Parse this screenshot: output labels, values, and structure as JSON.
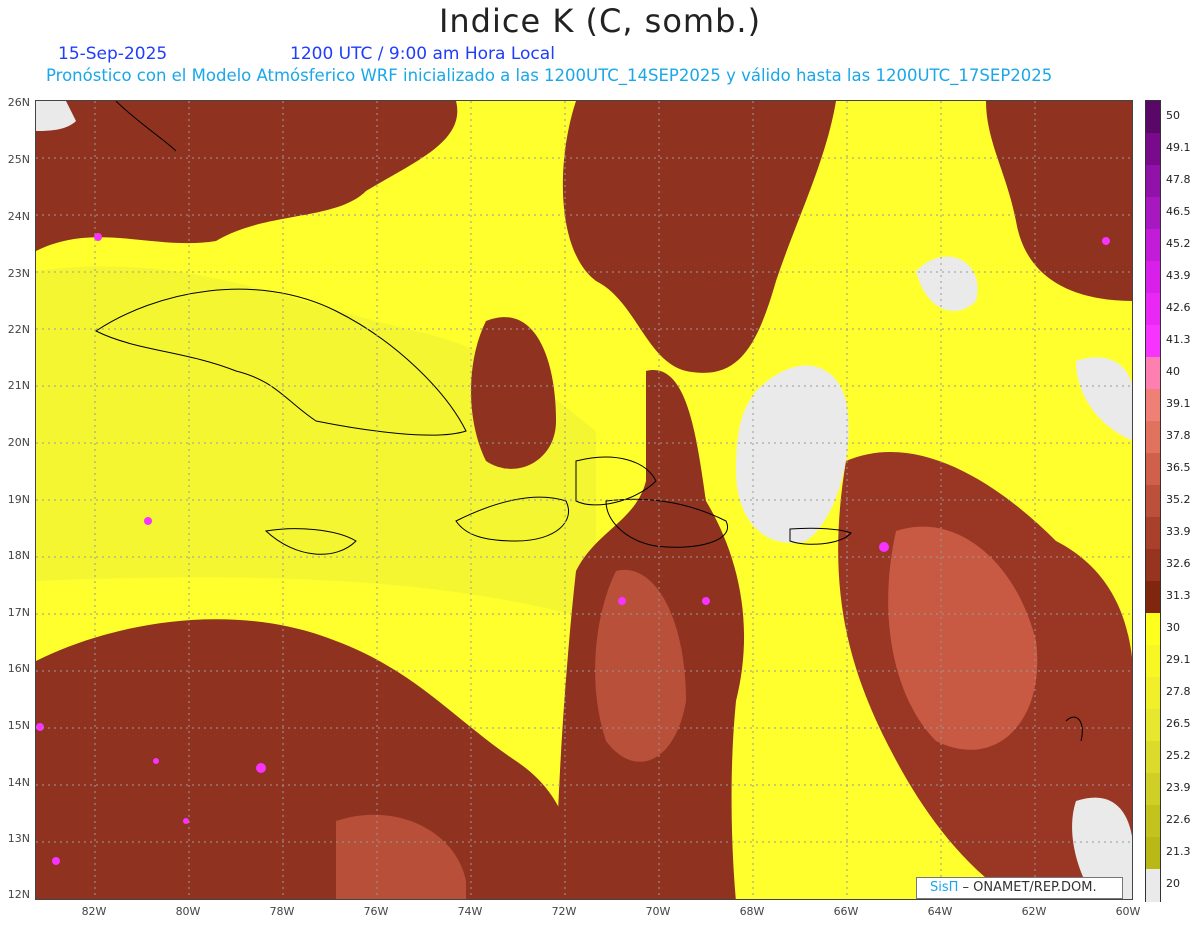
{
  "header": {
    "title": "Indice K (C, somb.)",
    "date": "15-Sep-2025",
    "time": "1200 UTC / 9:00 am Hora Local",
    "model_line": "Pronóstico con el Modelo Atmósferico WRF inicializado a las 1200UTC_14SEP2025 y válido hasta las  1200UTC_17SEP2025"
  },
  "axes": {
    "y_labels": [
      "26N",
      "25N",
      "24N",
      "23N",
      "22N",
      "21N",
      "20N",
      "19N",
      "18N",
      "17N",
      "16N",
      "15N",
      "14N",
      "13N",
      "12N"
    ],
    "x_labels": [
      "82W",
      "80W",
      "78W",
      "76W",
      "74W",
      "72W",
      "70W",
      "68W",
      "66W",
      "64W",
      "62W",
      "60W"
    ]
  },
  "colorbar": {
    "labels": [
      "50",
      "49.1",
      "47.8",
      "46.5",
      "45.2",
      "43.9",
      "42.6",
      "41.3",
      "40",
      "39.1",
      "37.8",
      "36.5",
      "35.2",
      "33.9",
      "32.6",
      "31.3",
      "30",
      "29.1",
      "27.8",
      "26.5",
      "25.2",
      "23.9",
      "22.6",
      "21.3",
      "20"
    ],
    "colors": [
      "#5a0868",
      "#7a0a8c",
      "#9012a8",
      "#a818c0",
      "#c21cd8",
      "#d820ea",
      "#ea28f6",
      "#f633ff",
      "#ff80b0",
      "#f08076",
      "#e0725e",
      "#d0604a",
      "#bc503a",
      "#a8402c",
      "#963420",
      "#80260f",
      "#ffff1e",
      "#f8f724",
      "#f0ef2a",
      "#e8e730",
      "#dcdb2c",
      "#d0cf26",
      "#c4c31e",
      "#b9b816",
      "#eaeaea"
    ]
  },
  "credit": {
    "brand": "SisΠ",
    "text": " – ONAMET/REP.DOM."
  }
}
